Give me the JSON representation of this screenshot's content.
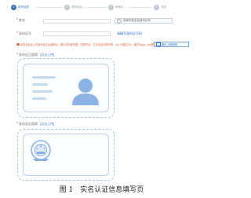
{
  "steps": [
    {
      "num": "1",
      "label": "填写信息"
    },
    {
      "num": "2",
      "label": "资料验证"
    },
    {
      "num": "3",
      "label": "审核中"
    },
    {
      "num": "4",
      "label": "完成"
    }
  ],
  "form": {
    "name_label": "姓名",
    "id_label": "身份证号",
    "name_hint_button": "请填写姓名及身份证号",
    "id_link": "请填写身份证号码"
  },
  "notice": {
    "text": "请您在此处上传身份证正反面照片，照片需清晰完整、四角齐全，文字信息清楚可辨，大小不超过2M，格式为jpg、png等常见图片格式。",
    "button": "图片上传说明"
  },
  "front": {
    "label": "身份证正面照",
    "action": "[点击上传]"
  },
  "back": {
    "label": "身份证反面照",
    "action": "[点击上传]"
  },
  "caption": "图 1　实名认证信息填写页",
  "colors": {
    "primary": "#3a6fb8",
    "dashed": "#a9c4e8",
    "warning": "#e0623a",
    "required": "#e03c3c"
  }
}
